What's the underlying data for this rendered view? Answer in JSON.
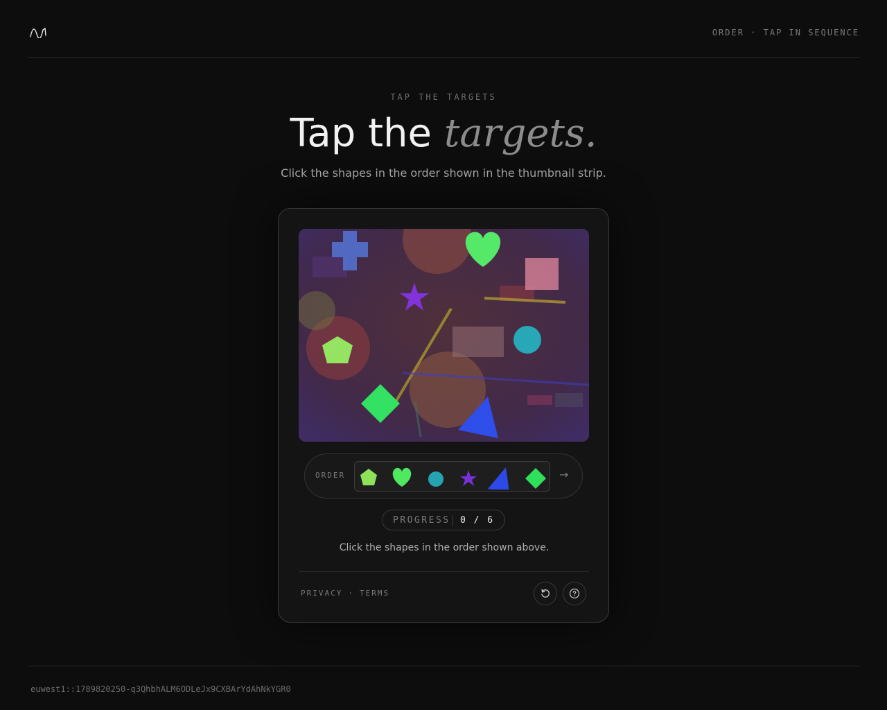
{
  "header": {
    "logo_icon": "wave-logo-icon",
    "mode_label": "ORDER · TAP IN SEQUENCE"
  },
  "hero": {
    "eyebrow": "TAP THE TARGETS",
    "title_main": "Tap the",
    "title_accent": "targets.",
    "subtitle": "Click the shapes in the order shown in the thumbnail strip."
  },
  "challenge": {
    "canvas_shapes": [
      {
        "shape": "cross",
        "color": "#4f6fd0"
      },
      {
        "shape": "heart",
        "color": "#4fe860"
      },
      {
        "shape": "square",
        "color": "#d57c8c"
      },
      {
        "shape": "star",
        "color": "#7a30d8"
      },
      {
        "shape": "pentagon",
        "color": "#8ce35a"
      },
      {
        "shape": "circle",
        "color": "#25a3b0"
      },
      {
        "shape": "diamond",
        "color": "#2fe05a"
      },
      {
        "shape": "triangle",
        "color": "#2b4ae8"
      }
    ],
    "order_label": "ORDER",
    "order_sequence": [
      {
        "shape": "pentagon",
        "color": "#8ce35a"
      },
      {
        "shape": "heart",
        "color": "#4fe860"
      },
      {
        "shape": "circle",
        "color": "#25a3b0"
      },
      {
        "shape": "star",
        "color": "#7a30d8"
      },
      {
        "shape": "triangle",
        "color": "#2b4ae8"
      },
      {
        "shape": "diamond",
        "color": "#2fe05a"
      }
    ],
    "next_icon": "arrow-right-icon",
    "next_glyph": "→",
    "progress_label": "PROGRESS",
    "progress_value": "0 / 6",
    "progress_current": 0,
    "progress_total": 6,
    "instruction": "Click the shapes in the order shown above."
  },
  "card_footer": {
    "privacy": "PRIVACY",
    "separator": "·",
    "terms": "TERMS",
    "reload_icon": "reload-icon",
    "help_icon": "help-icon"
  },
  "footer": {
    "session_id": "euwest1::1789820250-q3QhbhALM6ODLeJx9CXBArYdAhNkYGR0"
  }
}
